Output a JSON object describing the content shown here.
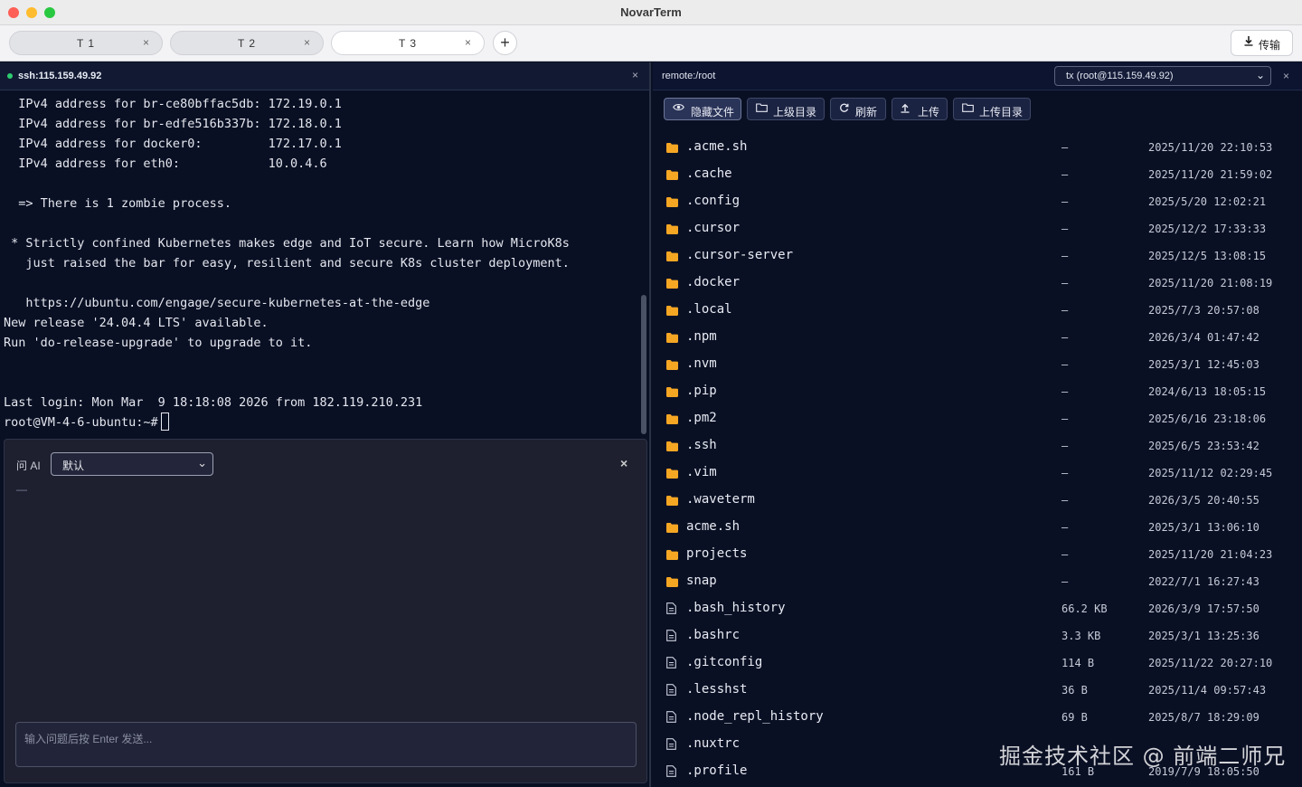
{
  "window": {
    "title": "NovarTerm"
  },
  "tabs": [
    {
      "label": "T 1",
      "close": "×"
    },
    {
      "label": "T 2",
      "close": "×"
    },
    {
      "label": "T 3",
      "close": "×"
    }
  ],
  "add_tab": "+",
  "transfer_button": {
    "icon": "download-icon",
    "label": "传输"
  },
  "terminal": {
    "host": "ssh:115.159.49.92",
    "close": "×",
    "lines": [
      "  IPv4 address for br-ce80bffac5db: 172.19.0.1",
      "  IPv4 address for br-edfe516b337b: 172.18.0.1",
      "  IPv4 address for docker0:         172.17.0.1",
      "  IPv4 address for eth0:            10.0.4.6",
      "",
      "  => There is 1 zombie process.",
      "",
      " * Strictly confined Kubernetes makes edge and IoT secure. Learn how MicroK8s",
      "   just raised the bar for easy, resilient and secure K8s cluster deployment.",
      "",
      "   https://ubuntu.com/engage/secure-kubernetes-at-the-edge",
      "New release '24.04.4 LTS' available.",
      "Run 'do-release-upgrade' to upgrade to it.",
      "",
      "",
      "Last login: Mon Mar  9 18:18:08 2026 from 182.119.210.231"
    ],
    "prompt": "root@VM-4-6-ubuntu:~#"
  },
  "ai": {
    "label": "问 AI",
    "mode_selected": "默认",
    "close": "×",
    "output": "—",
    "input_placeholder": "输入问题后按 Enter 发送..."
  },
  "files": {
    "path": "remote:/root",
    "connection": "tx (root@115.159.49.92)",
    "close": "×",
    "toolbar": {
      "hidden": "隐藏文件",
      "parent": "上级目录",
      "refresh": "刷新",
      "upload": "上传",
      "upload_dir": "上传目录"
    },
    "rows": [
      {
        "type": "folder",
        "name": ".acme.sh",
        "size": "—",
        "date": "2025/11/20 22:10:53"
      },
      {
        "type": "folder",
        "name": ".cache",
        "size": "—",
        "date": "2025/11/20 21:59:02"
      },
      {
        "type": "folder",
        "name": ".config",
        "size": "—",
        "date": "2025/5/20 12:02:21"
      },
      {
        "type": "folder",
        "name": ".cursor",
        "size": "—",
        "date": "2025/12/2 17:33:33"
      },
      {
        "type": "folder",
        "name": ".cursor-server",
        "size": "—",
        "date": "2025/12/5 13:08:15"
      },
      {
        "type": "folder",
        "name": ".docker",
        "size": "—",
        "date": "2025/11/20 21:08:19"
      },
      {
        "type": "folder",
        "name": ".local",
        "size": "—",
        "date": "2025/7/3 20:57:08"
      },
      {
        "type": "folder",
        "name": ".npm",
        "size": "—",
        "date": "2026/3/4 01:47:42"
      },
      {
        "type": "folder",
        "name": ".nvm",
        "size": "—",
        "date": "2025/3/1 12:45:03"
      },
      {
        "type": "folder",
        "name": ".pip",
        "size": "—",
        "date": "2024/6/13 18:05:15"
      },
      {
        "type": "folder",
        "name": ".pm2",
        "size": "—",
        "date": "2025/6/16 23:18:06"
      },
      {
        "type": "folder",
        "name": ".ssh",
        "size": "—",
        "date": "2025/6/5 23:53:42"
      },
      {
        "type": "folder",
        "name": ".vim",
        "size": "—",
        "date": "2025/11/12 02:29:45"
      },
      {
        "type": "folder",
        "name": ".waveterm",
        "size": "—",
        "date": "2026/3/5 20:40:55"
      },
      {
        "type": "folder",
        "name": "acme.sh",
        "size": "—",
        "date": "2025/3/1 13:06:10"
      },
      {
        "type": "folder",
        "name": "projects",
        "size": "—",
        "date": "2025/11/20 21:04:23"
      },
      {
        "type": "folder",
        "name": "snap",
        "size": "—",
        "date": "2022/7/1 16:27:43"
      },
      {
        "type": "file",
        "name": ".bash_history",
        "size": "66.2 KB",
        "date": "2026/3/9 17:57:50"
      },
      {
        "type": "file",
        "name": ".bashrc",
        "size": "3.3 KB",
        "date": "2025/3/1 13:25:36"
      },
      {
        "type": "file",
        "name": ".gitconfig",
        "size": "114 B",
        "date": "2025/11/22 20:27:10"
      },
      {
        "type": "file",
        "name": ".lesshst",
        "size": "36 B",
        "date": "2025/11/4 09:57:43"
      },
      {
        "type": "file",
        "name": ".node_repl_history",
        "size": "69 B",
        "date": "2025/8/7 18:29:09"
      },
      {
        "type": "file",
        "name": ".nuxtrc",
        "size": "",
        "date": ""
      },
      {
        "type": "file",
        "name": ".profile",
        "size": "161 B",
        "date": "2019/7/9 18:05:50"
      }
    ]
  },
  "watermark": "掘金技术社区 @ 前端二师兄"
}
